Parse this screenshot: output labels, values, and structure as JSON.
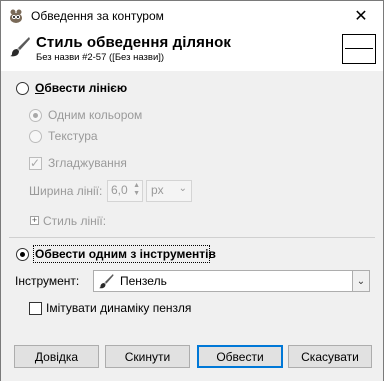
{
  "window": {
    "title": "Обведення за контуром",
    "close_symbol": "✕"
  },
  "header": {
    "title": "Стиль обведення ділянок",
    "subtitle": "Без назви #2-57 ([Без назви])"
  },
  "stroke_line": {
    "label": "Обвести лінією",
    "selected": false,
    "solid_color_label": "Одним кольором",
    "pattern_label": "Текстура",
    "antialias_label": "Згладжування",
    "antialias_checked": true,
    "width_label": "Ширина лінії:",
    "width_value": "6,0",
    "unit_value": "px",
    "line_style_label": "Стиль лінії:"
  },
  "stroke_tool": {
    "label": "Обвести одним з інструментів",
    "selected": true,
    "tool_label": "Інструмент:",
    "tool_value": "Пензель",
    "emulate_label": "Імітувати динаміку пензля",
    "emulate_checked": false
  },
  "buttons": {
    "help": "Довідка",
    "reset": "Скинути",
    "stroke": "Обвести",
    "cancel": "Скасувати"
  },
  "icons": {
    "app": "gimp-icon",
    "header": "paintbrush-icon",
    "tool": "paintbrush-icon"
  }
}
